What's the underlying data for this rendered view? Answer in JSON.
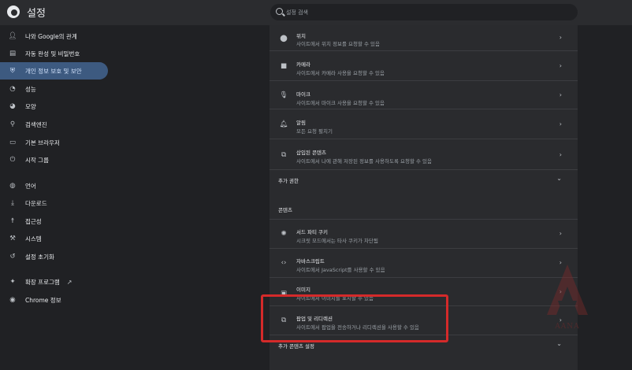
{
  "app": {
    "title": "설정"
  },
  "search": {
    "placeholder": "설정 검색"
  },
  "sidebar": {
    "items": [
      {
        "label": "나와 Google의 관계",
        "icon": "person-icon"
      },
      {
        "label": "자동 완성 및 비밀번호",
        "icon": "clipboard-icon"
      },
      {
        "label": "개인 정보 보호 및 보안",
        "icon": "shield-icon",
        "active": true
      },
      {
        "label": "성능",
        "icon": "speedometer-icon"
      },
      {
        "label": "모양",
        "icon": "palette-icon"
      },
      {
        "label": "검색엔진",
        "icon": "search-icon"
      },
      {
        "label": "기본 브라우저",
        "icon": "browser-icon"
      },
      {
        "label": "시작 그룹",
        "icon": "power-icon"
      },
      {
        "label": "언어",
        "icon": "globe-icon"
      },
      {
        "label": "다운로드",
        "icon": "download-icon"
      },
      {
        "label": "접근성",
        "icon": "accessibility-icon"
      },
      {
        "label": "시스템",
        "icon": "wrench-icon"
      },
      {
        "label": "설정 초기화",
        "icon": "history-icon"
      },
      {
        "label": "확장 프로그램",
        "icon": "puzzle-icon",
        "external": true
      },
      {
        "label": "Chrome 정보",
        "icon": "chrome-icon"
      }
    ]
  },
  "permissions": [
    {
      "title": "위치",
      "subtitle": "사이트에서 위치 정보를 요청할 수 있음",
      "icon": "location-icon"
    },
    {
      "title": "카메라",
      "subtitle": "사이트에서 카메라 사용을 요청할 수 있음",
      "icon": "camera-icon"
    },
    {
      "title": "마이크",
      "subtitle": "사이트에서 마이크 사용을 요청할 수 있음",
      "icon": "mic-icon"
    },
    {
      "title": "알림",
      "subtitle": "모든 요청 펼치기",
      "icon": "bell-icon"
    },
    {
      "title": "삽입된 콘텐츠",
      "subtitle": "사이트에서 나에 관해 저장된 정보를 사용하도록 요청할 수 있음",
      "icon": "embedded-content-icon"
    }
  ],
  "additional_permissions": {
    "label": "추가 권한"
  },
  "content_section": {
    "label": "콘텐츠"
  },
  "content": [
    {
      "title": "서드 파티 쿠키",
      "subtitle": "시크릿 모드에서는 타사 쿠키가 차단됨",
      "icon": "cookie-icon"
    },
    {
      "title": "자바스크립트",
      "subtitle": "사이트에서 JavaScript를 사용할 수 있음",
      "icon": "code-icon"
    },
    {
      "title": "이미지",
      "subtitle": "사이트에서 이미지를 표시할 수 있음",
      "icon": "image-icon"
    },
    {
      "title": "팝업 및 리디렉션",
      "subtitle": "사이트에서 팝업을 전송하거나 리디렉션을 사용할 수 있음",
      "icon": "popup-icon"
    }
  ],
  "additional_content": {
    "label": "추가 콘텐츠 설정"
  },
  "watermark": {
    "text": "AANA"
  },
  "colors": {
    "highlight": "#d42a2a",
    "active_nav": "#3d5a80"
  }
}
